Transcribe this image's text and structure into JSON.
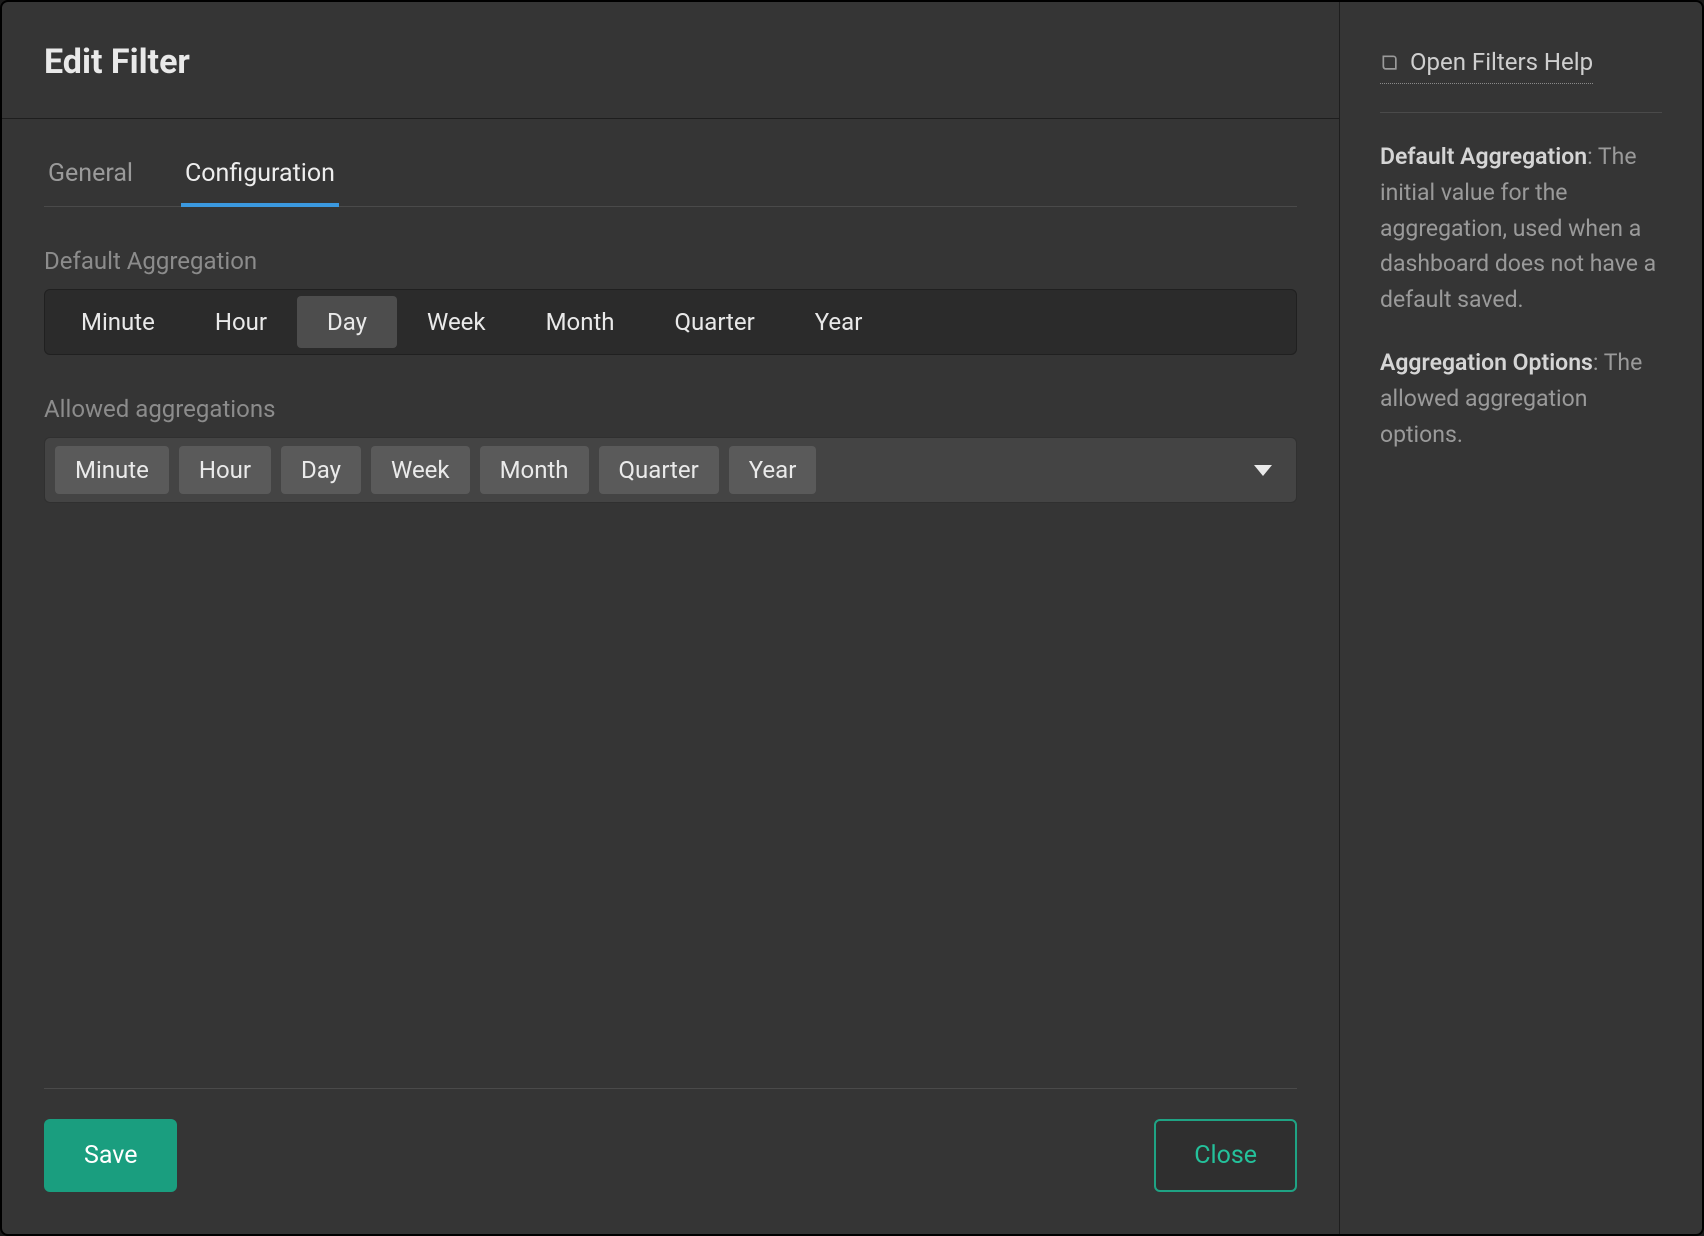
{
  "header": {
    "title": "Edit Filter"
  },
  "tabs": [
    {
      "id": "general",
      "label": "General",
      "active": false
    },
    {
      "id": "configuration",
      "label": "Configuration",
      "active": true
    }
  ],
  "defaultAggregation": {
    "label": "Default Aggregation",
    "options": [
      "Minute",
      "Hour",
      "Day",
      "Week",
      "Month",
      "Quarter",
      "Year"
    ],
    "selected": "Day"
  },
  "allowedAggregations": {
    "label": "Allowed aggregations",
    "values": [
      "Minute",
      "Hour",
      "Day",
      "Week",
      "Month",
      "Quarter",
      "Year"
    ]
  },
  "footer": {
    "save": "Save",
    "close": "Close"
  },
  "sidebar": {
    "helpLink": "Open Filters Help",
    "items": [
      {
        "term": "Default Aggregation",
        "desc": ": The initial value for the aggregation, used when a dashboard does not have a default saved."
      },
      {
        "term": "Aggregation Options",
        "desc": ": The allowed aggregation options."
      }
    ]
  }
}
